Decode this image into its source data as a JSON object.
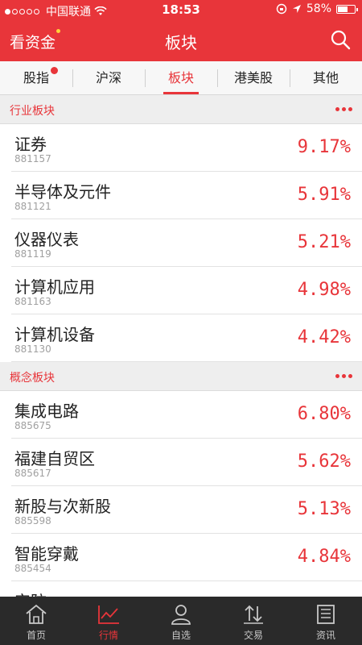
{
  "status_bar": {
    "carrier": "中国联通",
    "time": "18:53",
    "battery": "58%",
    "battery_level": 0.58,
    "signal_dots_filled": 1,
    "signal_dots_total": 5
  },
  "navbar": {
    "left_title": "看资金",
    "title": "板块"
  },
  "tabs": [
    {
      "label": "股指",
      "badge": true
    },
    {
      "label": "沪深"
    },
    {
      "label": "板块",
      "active": true
    },
    {
      "label": "港美股"
    },
    {
      "label": "其他"
    }
  ],
  "sections": [
    {
      "title": "行业板块",
      "rows": [
        {
          "name": "证券",
          "code": "881157",
          "pct": "9.17%"
        },
        {
          "name": "半导体及元件",
          "code": "881121",
          "pct": "5.91%"
        },
        {
          "name": "仪器仪表",
          "code": "881119",
          "pct": "5.21%"
        },
        {
          "name": "计算机应用",
          "code": "881163",
          "pct": "4.98%"
        },
        {
          "name": "计算机设备",
          "code": "881130",
          "pct": "4.42%"
        }
      ]
    },
    {
      "title": "概念板块",
      "rows": [
        {
          "name": "集成电路",
          "code": "885675",
          "pct": "6.80%"
        },
        {
          "name": "福建自贸区",
          "code": "885617",
          "pct": "5.62%"
        },
        {
          "name": "新股与次新股",
          "code": "885598",
          "pct": "5.13%"
        },
        {
          "name": "智能穿戴",
          "code": "885454",
          "pct": "4.84%"
        },
        {
          "name": "安防",
          "code": "",
          "pct": ""
        }
      ]
    }
  ],
  "bottom_tabs": [
    {
      "label": "首页",
      "icon": "home-icon"
    },
    {
      "label": "行情",
      "icon": "chart-icon",
      "active": true
    },
    {
      "label": "自选",
      "icon": "user-icon"
    },
    {
      "label": "交易",
      "icon": "trade-icon"
    },
    {
      "label": "资讯",
      "icon": "news-icon"
    }
  ],
  "colors": {
    "accent": "#e8353a",
    "bottom_bar": "#2a2a2a"
  }
}
